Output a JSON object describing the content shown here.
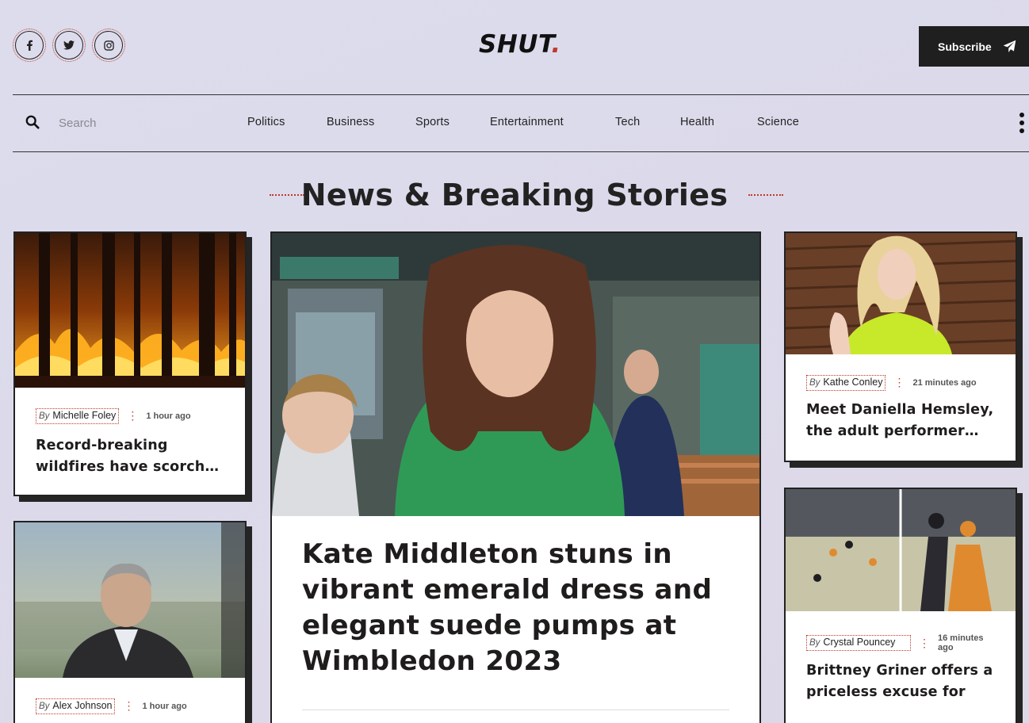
{
  "brand": {
    "logo_text": "SHUT",
    "logo_dot": ".",
    "accent": "#c0392b"
  },
  "social": [
    {
      "name": "facebook-icon",
      "glyph": "f"
    },
    {
      "name": "twitter-icon",
      "glyph": "t"
    },
    {
      "name": "instagram-icon",
      "glyph": "i"
    }
  ],
  "subscribe": {
    "label": "Subscribe",
    "icon": "send-icon"
  },
  "search": {
    "placeholder": "Search"
  },
  "nav": [
    "Politics",
    "Business",
    "Sports",
    "Entertainment",
    "Tech",
    "Health",
    "Science"
  ],
  "section": {
    "title": "News & Breaking Stories"
  },
  "cards": {
    "left1": {
      "by": "By",
      "author": "Michelle Foley",
      "time": "1 hour ago",
      "headline": "Record-breaking wildfires have scorched millions of acres",
      "image": "forest-wildfire-photo"
    },
    "left2": {
      "by": "By",
      "author": "Alex Johnson",
      "time": "1 hour ago",
      "image": "politician-portrait-photo"
    },
    "feature": {
      "headline": "Kate Middleton stuns in vibrant emerald dress and elegant suede pumps at Wimbledon 2023",
      "image": "kate-middleton-wimbledon-photo"
    },
    "right1": {
      "by": "By",
      "author": "Kathe Conley",
      "time": "21 minutes ago",
      "headline": "Meet Daniella Hemsley, the adult performer who",
      "image": "blonde-woman-photo"
    },
    "right2": {
      "by": "By",
      "author": "Crystal Pouncey",
      "time": "16 minutes ago",
      "headline": "Brittney Griner offers a priceless excuse for",
      "image": "basketball-game-photo"
    }
  }
}
